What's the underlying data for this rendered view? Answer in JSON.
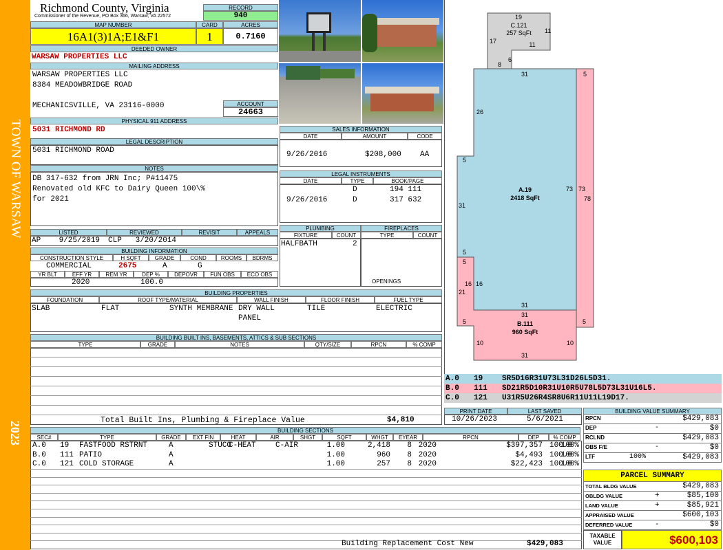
{
  "sidebar": {
    "town": "TOWN OF WARSAW",
    "year": "2023"
  },
  "header": {
    "county": "Richmond County, Virginia",
    "commissioner": "Commissioner of the Revenue, PO Box 366, Warsaw, VA 22572",
    "record_label": "RECORD",
    "record": "940",
    "map_label": "MAP NUMBER",
    "map_number": "16A1(3)1A;E1&F1",
    "card_label": "CARD",
    "card": "1",
    "acres_label": "ACRES",
    "acres": "0.7160"
  },
  "owner": {
    "label": "DEEDED OWNER",
    "name": "WARSAW PROPERTIES LLC"
  },
  "mailing": {
    "label": "MAILING ADDRESS",
    "lines": [
      "WARSAW PROPERTIES LLC",
      "8384 MEADOWBRIDGE ROAD",
      "",
      "MECHANICSVILLE, VA 23116-0000"
    ],
    "account_label": "ACCOUNT",
    "account": "24663"
  },
  "physical": {
    "label": "PHYSICAL 911 ADDRESS",
    "value": "5031 RICHMOND RD"
  },
  "legal": {
    "label": "LEGAL DESCRIPTION",
    "value": "5031 RICHMOND ROAD"
  },
  "notes": {
    "label": "NOTES",
    "lines": [
      "DB 317-632 from JRN Inc; P#11475",
      "Renovated old KFC to Dairy Queen 100\\%",
      "for 2021"
    ]
  },
  "sales": {
    "label": "SALES INFORMATION",
    "cols": [
      "DATE",
      "AMOUNT",
      "CODE"
    ],
    "rows": [
      {
        "date": "9/26/2016",
        "amount": "$208,000",
        "code": "AA"
      }
    ]
  },
  "instruments": {
    "label": "LEGAL INSTRUMENTS",
    "cols": [
      "DATE",
      "TYPE",
      "BOOK/PAGE"
    ],
    "rows": [
      {
        "date": "",
        "type": "D",
        "book": "194 111"
      },
      {
        "date": "9/26/2016",
        "type": "D",
        "book": "317 632"
      }
    ]
  },
  "status": {
    "cols": [
      "LISTED",
      "REVIEWED",
      "REVISIT",
      "APPEALS"
    ],
    "listed": "AP    9/25/2019",
    "reviewed": "CLP   3/20/2014"
  },
  "plumbing": {
    "label": "PLUMBING",
    "cols": [
      "FIXTURE",
      "COUNT"
    ],
    "fixture": "HALFBATH",
    "count": "2"
  },
  "fireplaces": {
    "label": "FIREPLACES",
    "cols": [
      "TYPE",
      "COUNT"
    ],
    "openings": "OPENINGS"
  },
  "building_info": {
    "label": "BUILDING INFORMATION",
    "cols1": [
      "CONSTRUCTION STYLE",
      "H SQFT",
      "GRADE",
      "COND",
      "ROOMS",
      "BDRMS"
    ],
    "style": "COMMERCIAL",
    "hsqft": "2675",
    "grade": "A",
    "cond": "G",
    "cols2": [
      "YR BLT",
      "EFF YR",
      "REM YR",
      "DEP %",
      "DEPOVR",
      "FUN OBS",
      "ECO OBS"
    ],
    "eff_yr": "2020",
    "dep": "100.0"
  },
  "building_props": {
    "label": "BUILDING PROPERTIES",
    "cols": [
      "FOUNDATION",
      "ROOF TYPE/MATERIAL",
      "WALL FINISH",
      "FLOOR FINISH",
      "FUEL TYPE"
    ],
    "foundation": "SLAB",
    "roof_type": "FLAT",
    "roof_material": "SYNTH MEMBRANE",
    "wall1": "DRY WALL",
    "wall2": "PANEL",
    "floor": "TILE",
    "fuel": "ELECTRIC"
  },
  "built_ins": {
    "label": "BUILDING BUILT INS, BASEMENTS, ATTICS & SUB SECTIONS",
    "cols": [
      "TYPE",
      "GRADE",
      "NOTES",
      "QTY/SIZE",
      "RPCN",
      "% COMP"
    ],
    "total_label": "Total Built Ins, Plumbing & Fireplace Value",
    "total": "$4,810"
  },
  "dates": {
    "print_label": "PRINT DATE",
    "print": "10/26/2023",
    "saved_label": "LAST SAVED",
    "saved": "5/6/2021"
  },
  "sketch_legend": [
    {
      "sec": "A.0",
      "code": "19",
      "desc": "SR5D16R31U73L31D26L5D31.",
      "color": "#add8e6"
    },
    {
      "sec": "B.0",
      "code": "111",
      "desc": "SD21R5D10R31U10R5U78L5D73L31U16L5.",
      "color": "#ffb6c1"
    },
    {
      "sec": "C.0",
      "code": "121",
      "desc": "U31R5U26R4SR8U6R11U11L19D17.",
      "color": "#d3d3d3"
    }
  ],
  "sketch": {
    "a_label": "A.19",
    "a_area": "2418 SqFt",
    "b_label": "B.111",
    "b_area": "960 SqFt",
    "c_label": "C.121",
    "c_area": "257 SqFt",
    "dims": [
      "19",
      "11",
      "17",
      "11",
      "8",
      "6",
      "31",
      "5",
      "26",
      "5",
      "31",
      "73",
      "73",
      "78",
      "5",
      "5",
      "16",
      "16",
      "21",
      "31",
      "31",
      "5",
      "5",
      "10",
      "10",
      "31"
    ]
  },
  "value_summary": {
    "label": "BUILDING VALUE SUMMARY",
    "rows": [
      {
        "k": "RPCN",
        "op": "",
        "v": "$429,083"
      },
      {
        "k": "DEP",
        "op": "-",
        "v": "$0"
      },
      {
        "k": "RCLND",
        "op": "",
        "v": "$429,083"
      },
      {
        "k": "OBS F/E",
        "op": "-",
        "v": "$0"
      },
      {
        "k": "LTF",
        "op": "100%",
        "v": "$429,083"
      }
    ]
  },
  "parcel": {
    "label": "PARCEL SUMMARY",
    "rows": [
      {
        "k": "TOTAL BLDG VALUE",
        "op": "",
        "v": "$429,083"
      },
      {
        "k": "OBLDG VALUE",
        "op": "+",
        "v": "$85,100"
      },
      {
        "k": "LAND VALUE",
        "op": "+",
        "v": "$85,921"
      },
      {
        "k": "APPRAISED VALUE",
        "op": "",
        "v": "$600,103"
      },
      {
        "k": "DEFERRED VALUE",
        "op": "-",
        "v": "$0"
      }
    ],
    "taxable_label": "TAXABLE VALUE",
    "taxable": "$600,103"
  },
  "sections": {
    "label": "BUILDING SECTIONS",
    "cols": [
      "SEC#",
      "TYPE",
      "GRADE",
      "EXT FIN",
      "HEAT",
      "AIR",
      "SHGT",
      "SQFT",
      "WHGT",
      "EYEAR",
      "RPCN",
      "DEP",
      "% COMP"
    ],
    "rows": [
      {
        "sec": "A.0",
        "code": "19",
        "type": "FASTFOOD RSTRNT",
        "grade": "A",
        "ext": "STUCO",
        "heat": "C-HEAT",
        "air": "C-AIR",
        "shgt": "1.00",
        "sqft": "2,418",
        "whgt": "8",
        "eyear": "2020",
        "rpcn": "$397,357",
        "dep": "100.0",
        "comp": "100%"
      },
      {
        "sec": "B.0",
        "code": "111",
        "type": "PATIO",
        "grade": "A",
        "ext": "",
        "heat": "",
        "air": "",
        "shgt": "1.00",
        "sqft": "960",
        "whgt": "8",
        "eyear": "2020",
        "rpcn": "$4,493",
        "dep": "100.0",
        "comp": "100%"
      },
      {
        "sec": "C.0",
        "code": "121",
        "type": "COLD STORAGE",
        "grade": "A",
        "ext": "",
        "heat": "",
        "air": "",
        "shgt": "1.00",
        "sqft": "257",
        "whgt": "8",
        "eyear": "2020",
        "rpcn": "$22,423",
        "dep": "100.0",
        "comp": "100%"
      }
    ],
    "total_label": "Building Replacement Cost New",
    "total": "$429,083"
  },
  "colors": {
    "sidebar": "#ffa500",
    "header": "#add8e6",
    "accent_red": "#c00000",
    "highlight": "#ffff00",
    "record_bg": "#90ee90"
  }
}
